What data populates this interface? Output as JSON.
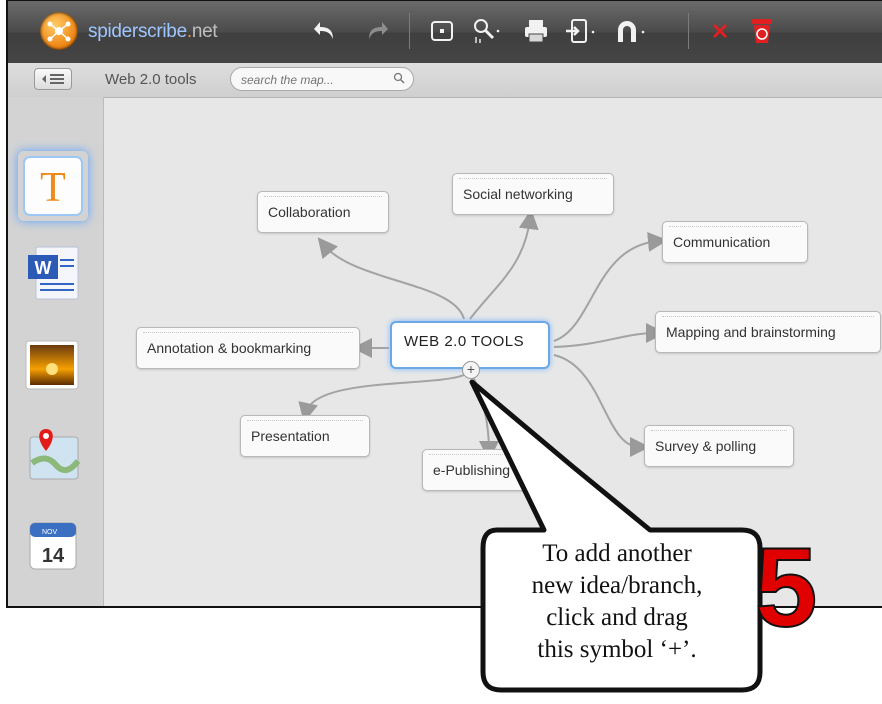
{
  "app": {
    "logo_name": "spiderscribe",
    "logo_dot": ".",
    "logo_net": "net",
    "logo_full": "spiderscribe.net"
  },
  "toolbar": {
    "icons": [
      "logo-icon",
      "undo-icon",
      "redo-icon",
      "fit-screen-icon",
      "zoom-icon",
      "print-icon",
      "import-icon",
      "magnet-icon",
      "close-icon",
      "trash-icon"
    ]
  },
  "subbar": {
    "map_title": "Web 2.0 tools",
    "search_placeholder": "search the map..."
  },
  "sidebar": {
    "items": [
      "text-note-icon",
      "word-document-icon",
      "image-icon",
      "map-marker-icon",
      "calendar-icon"
    ],
    "calendar_month": "NOV",
    "calendar_day": "14"
  },
  "map": {
    "center": "WEB 2.0 TOOLS",
    "nodes": {
      "collaboration": "Collaboration",
      "social": "Social networking",
      "communication": "Communication",
      "mapping": "Mapping and brainstorming",
      "annotation": "Annotation & bookmarking",
      "presentation": "Presentation",
      "epublishing": "e-Publishing",
      "survey": "Survey & polling"
    },
    "plus_symbol": "+"
  },
  "callout": {
    "line1": "To add another",
    "line2": "new idea/branch,",
    "line3": "click and drag",
    "line4": "this symbol ‘+’.",
    "step": "5"
  },
  "colors": {
    "toolbar": "#4a4a4a",
    "accent_blue": "#6aa8e6",
    "step_red": "#e10000",
    "close_red": "#e02020"
  }
}
